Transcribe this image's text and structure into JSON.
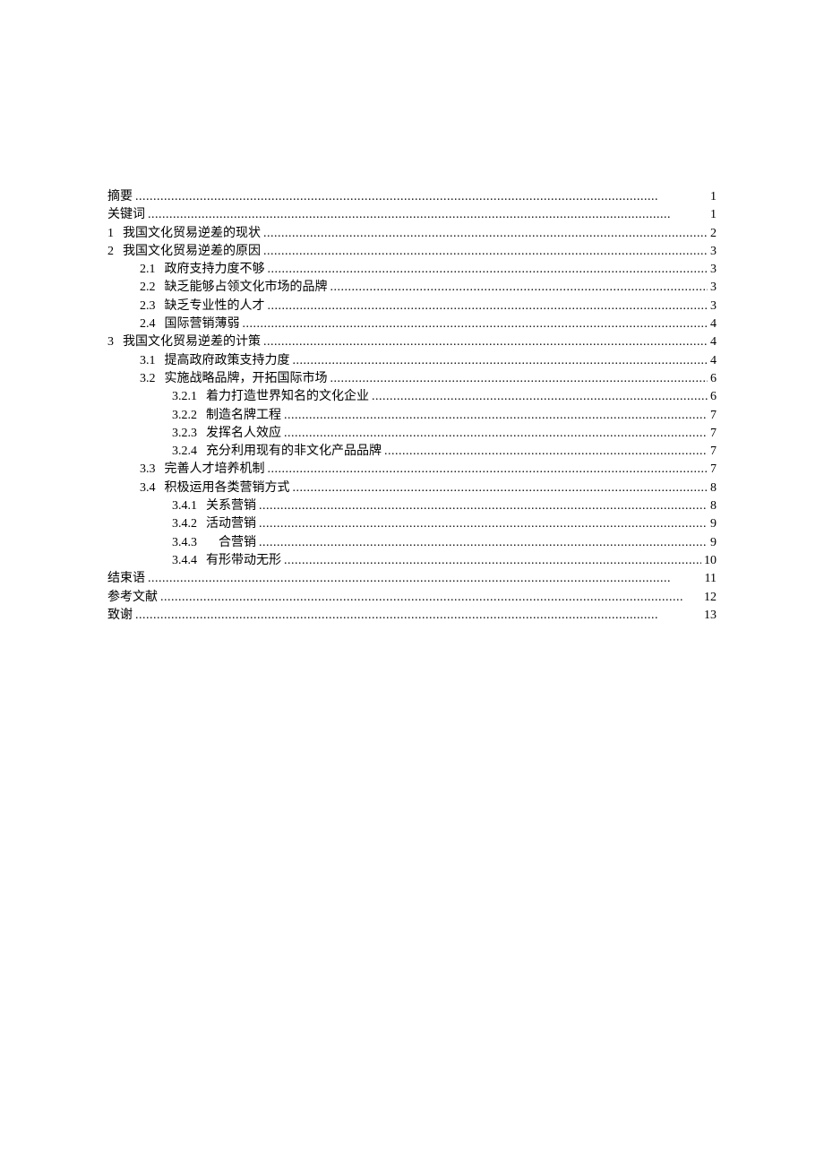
{
  "toc": [
    {
      "level": 0,
      "num": "",
      "title": "摘要",
      "page": "1"
    },
    {
      "level": 0,
      "num": "",
      "title": "关键词",
      "page": "1"
    },
    {
      "level": 0,
      "num": "1",
      "title": "我国文化贸易逆差的现状",
      "page": "2"
    },
    {
      "level": 0,
      "num": "2",
      "title": "我国文化贸易逆差的原因",
      "page": "3"
    },
    {
      "level": 1,
      "num": "2.1",
      "title": "政府支持力度不够",
      "page": "3"
    },
    {
      "level": 1,
      "num": "2.2",
      "title": "缺乏能够占领文化市场的品牌",
      "page": "3"
    },
    {
      "level": 1,
      "num": "2.3",
      "title": "缺乏专业性的人才",
      "page": "3"
    },
    {
      "level": 1,
      "num": "2.4",
      "title": "国际营销薄弱",
      "page": "4"
    },
    {
      "level": 0,
      "num": "3",
      "title": "我国文化贸易逆差的计策",
      "page": "4"
    },
    {
      "level": 1,
      "num": "3.1",
      "title": "提高政府政策支持力度",
      "page": "4"
    },
    {
      "level": 1,
      "num": "3.2",
      "title": "实施战略品牌，开拓国际市场",
      "page": "6"
    },
    {
      "level": 2,
      "num": "3.2.1",
      "title": "着力打造世界知名的文化企业",
      "page": "6"
    },
    {
      "level": 2,
      "num": "3.2.2",
      "title": "制造名牌工程",
      "page": "7"
    },
    {
      "level": 2,
      "num": "3.2.3",
      "title": "发挥名人效应",
      "page": "7"
    },
    {
      "level": 2,
      "num": "3.2.4",
      "title": "充分利用现有的非文化产品品牌",
      "page": "7"
    },
    {
      "level": 1,
      "num": "3.3",
      "title": "完善人才培养机制",
      "page": "7"
    },
    {
      "level": 1,
      "num": "3.4",
      "title": "积极运用各类营销方式",
      "page": "8"
    },
    {
      "level": 2,
      "num": "3.4.1",
      "title": "关系营销",
      "page": "8"
    },
    {
      "level": 2,
      "num": "3.4.2",
      "title": "活动营销",
      "page": "9"
    },
    {
      "level": 2,
      "num": "3.4.3",
      "title": "　合营销",
      "page": "9"
    },
    {
      "level": 2,
      "num": "3.4.4",
      "title": "有形带动无形",
      "page": "10"
    },
    {
      "level": 0,
      "num": "",
      "title": "结束语",
      "page": "11"
    },
    {
      "level": 0,
      "num": "",
      "title": "参考文献",
      "page": "12"
    },
    {
      "level": 0,
      "num": "",
      "title": "致谢",
      "page": "13"
    }
  ]
}
